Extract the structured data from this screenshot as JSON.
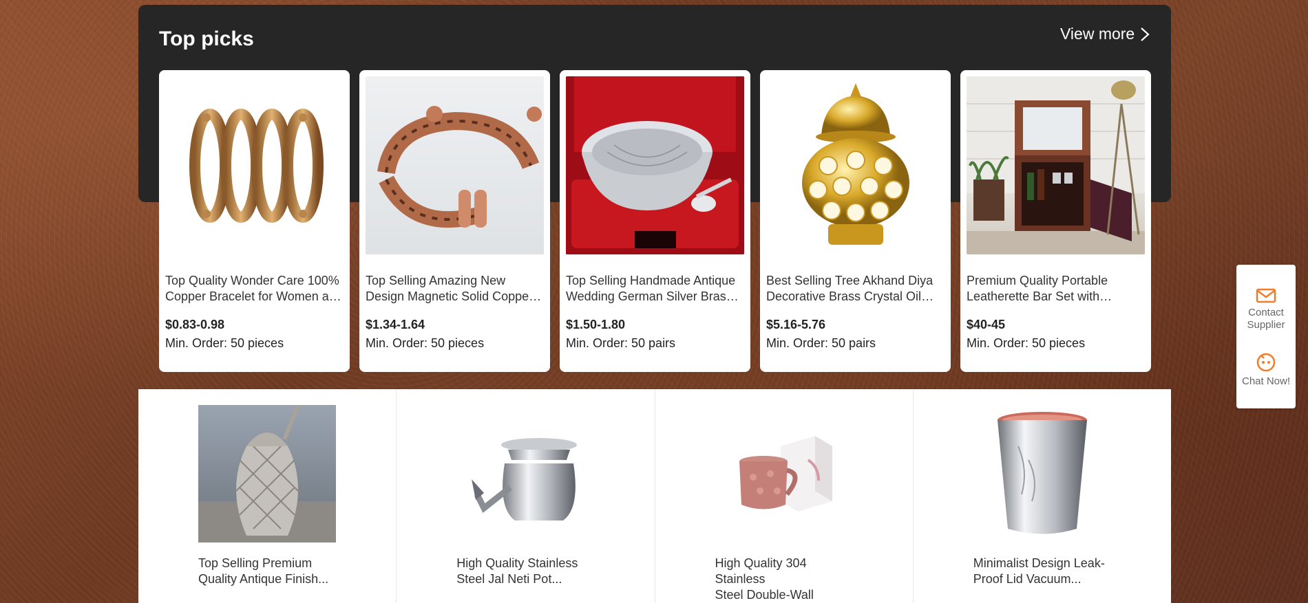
{
  "section": {
    "title": "Top picks",
    "view_more_label": "View more"
  },
  "top_picks": [
    {
      "title": "Top Quality Wonder Care 100% Copper Bracelet for Women and Men",
      "price": "$0.83-0.98",
      "min_order": "Min. Order: 50 pieces",
      "image_icon": "copper-bracelets-image"
    },
    {
      "title": "Top Selling Amazing New Design Magnetic Solid Copper Cuff Bracelet",
      "price": "$1.34-1.64",
      "min_order": "Min. Order: 50 pieces",
      "image_icon": "copper-cuff-image"
    },
    {
      "title": "Top Selling Handmade Antique Wedding German Silver Brass Bowl",
      "price": "$1.50-1.80",
      "min_order": "Min. Order: 50 pairs",
      "image_icon": "silver-bowl-image"
    },
    {
      "title": "Best Selling Tree Akhand Diya Decorative Brass Crystal Oil Lamp",
      "price": "$5.16-5.76",
      "min_order": "Min. Order: 50 pairs",
      "image_icon": "brass-diya-image"
    },
    {
      "title": "Premium Quality Portable Leatherette Bar Set with Whiskey Glasses",
      "price": "$40-45",
      "min_order": "Min. Order: 50 pieces",
      "image_icon": "bar-set-image"
    }
  ],
  "more_products": [
    {
      "title_line1": "Top Selling Premium",
      "title_line2": "Quality Antique Finish...",
      "image_icon": "pineapple-tumbler-image"
    },
    {
      "title_line1": "High Quality Stainless",
      "title_line2": "Steel Jal Neti Pot...",
      "image_icon": "neti-pot-image"
    },
    {
      "title_line1": "High Quality 304 Stainless",
      "title_line2": "Steel Double-Wall Coffee...",
      "image_icon": "copper-mug-image"
    },
    {
      "title_line1": "Minimalist Design Leak-",
      "title_line2": "Proof Lid Vacuum...",
      "image_icon": "steel-tumbler-image"
    }
  ],
  "side_widget": {
    "contact_line1": "Contact",
    "contact_line2": "Supplier",
    "chat_label": "Chat Now!"
  },
  "colors": {
    "accent_orange": "#f07c2a",
    "dark_panel": "#262626"
  }
}
